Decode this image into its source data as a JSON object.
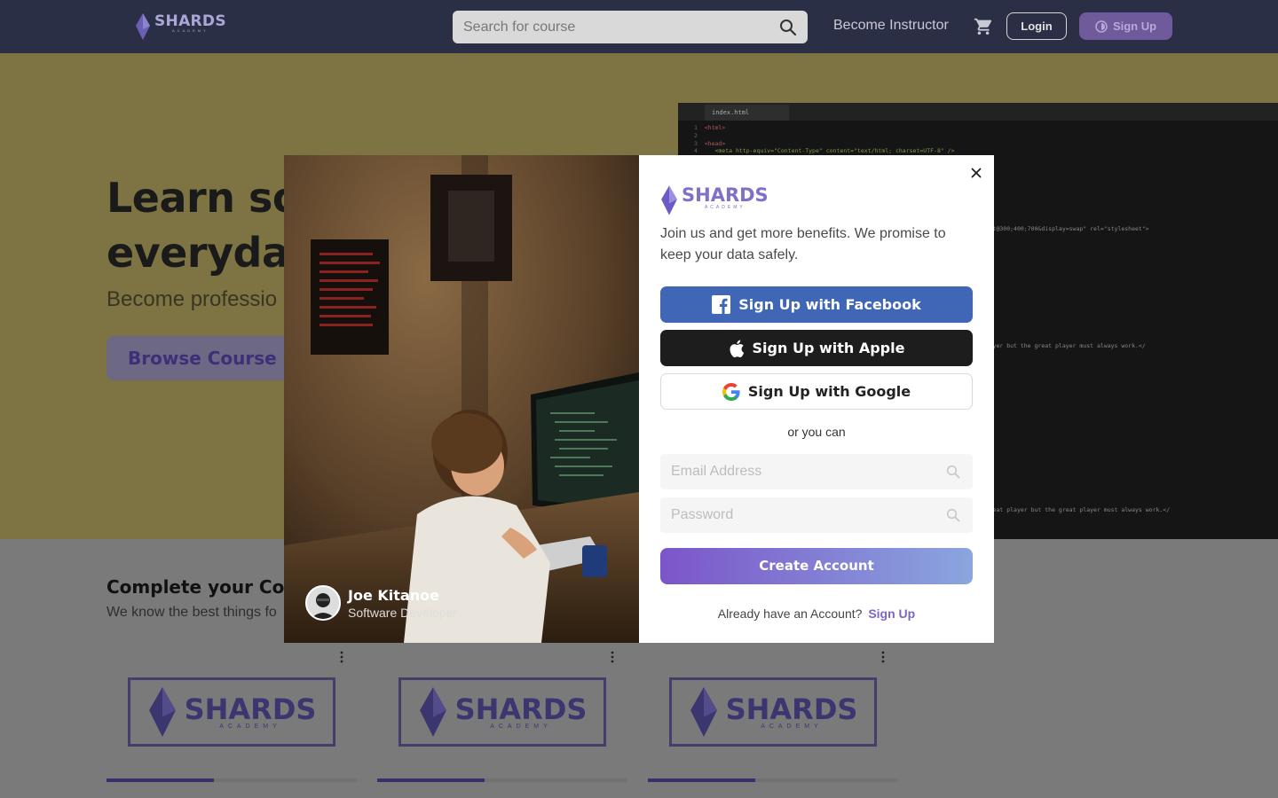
{
  "nav": {
    "brand": "SHARDS",
    "brand_sub": "ACADEMY",
    "search_placeholder": "Search for course",
    "become_instructor": "Become Instructor",
    "login": "Login",
    "signup": "Sign Up"
  },
  "hero": {
    "title_line1": "Learn so",
    "title_line2": "everyda",
    "subtitle": "Become professio",
    "cta": "Browse Course",
    "code_tab": "index.html"
  },
  "courses": {
    "title": "Complete your Cou",
    "subtitle": "We know the best things fo",
    "items": [
      {
        "brand": "SHARDS",
        "sub": "ACADEMY",
        "progress": 0.43
      },
      {
        "brand": "SHARDS",
        "sub": "ACADEMY",
        "progress": 0.43
      },
      {
        "brand": "SHARDS",
        "sub": "ACADEMY",
        "progress": 0.43
      }
    ]
  },
  "modal": {
    "author_name": "Joe Kitanoe",
    "author_role": "Software Developer",
    "logo_name": "SHARDS",
    "logo_sub": "ACADEMY",
    "intro": "Join us and get more benefits. We promise to keep your data safely.",
    "facebook": "Sign Up with Facebook",
    "apple": "Sign Up with Apple",
    "google": "Sign Up with Google",
    "divider": "or you can",
    "email_placeholder": "Email Address",
    "password_placeholder": "Password",
    "create": "Create Account",
    "have_account": "Already have an Account?",
    "signup_link": "Sign Up"
  },
  "colors": {
    "accent": "#7b55c9",
    "facebook": "#3f67b5",
    "apple": "#1d1d1d"
  },
  "icons": [
    "shards-logo-icon",
    "search-icon",
    "cart-icon",
    "close-icon",
    "facebook-icon",
    "apple-icon",
    "google-icon",
    "more-vertical-icon"
  ]
}
